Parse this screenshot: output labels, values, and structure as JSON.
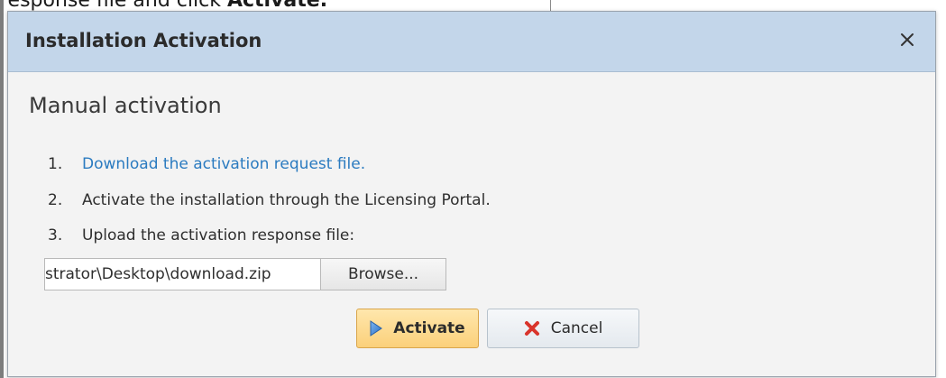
{
  "background_text": {
    "part1": "response file and click ",
    "part2": "Activate."
  },
  "dialog": {
    "title": "Installation Activation",
    "close_glyph": "✕",
    "heading": "Manual activation",
    "steps": [
      {
        "number": "1.",
        "text": "Download the activation request file.",
        "is_link": true
      },
      {
        "number": "2.",
        "text": "Activate the installation through the Licensing Portal.",
        "is_link": false
      },
      {
        "number": "3.",
        "text": "Upload the activation response file:",
        "is_link": false
      }
    ],
    "file_path_value": "strator\\Desktop\\download.zip",
    "browse_label": "Browse...",
    "activate_label": "Activate",
    "cancel_label": "Cancel"
  },
  "icons": {
    "close": "close-icon",
    "activate": "play-arrow-icon",
    "cancel": "red-x-icon"
  },
  "colors": {
    "titlebar": "#c3d6ea",
    "link": "#2b7bc0",
    "activate_button": "#fbd07a",
    "cancel_icon": "#d9342b",
    "activate_icon": "#3b7fd0"
  }
}
